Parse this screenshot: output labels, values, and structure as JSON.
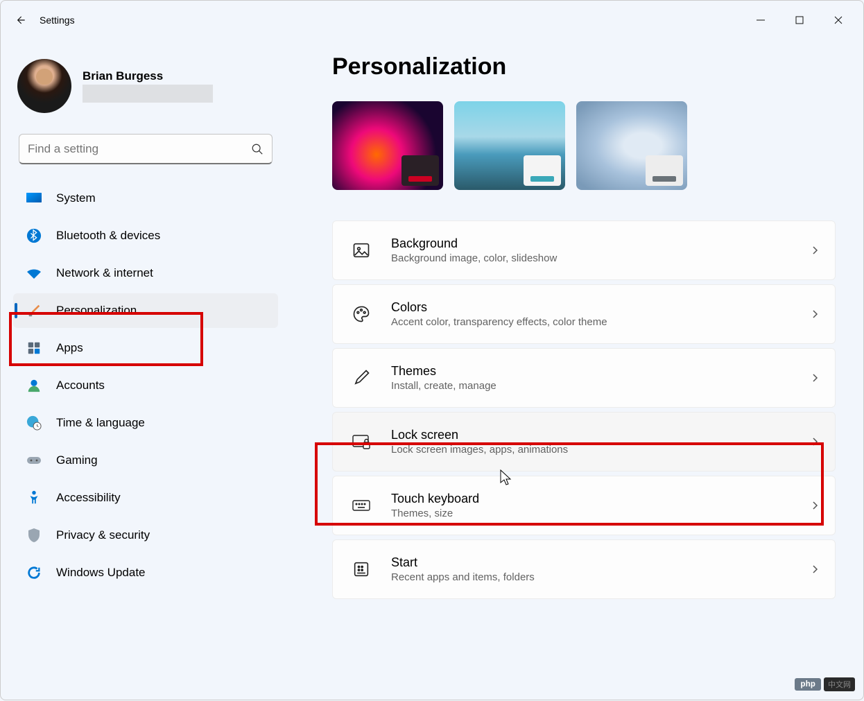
{
  "app": {
    "title": "Settings"
  },
  "user": {
    "name": "Brian Burgess"
  },
  "search": {
    "placeholder": "Find a setting"
  },
  "sidebar": {
    "items": [
      {
        "icon": "system",
        "label": "System"
      },
      {
        "icon": "bluetooth",
        "label": "Bluetooth & devices"
      },
      {
        "icon": "wifi",
        "label": "Network & internet"
      },
      {
        "icon": "brush",
        "label": "Personalization"
      },
      {
        "icon": "apps",
        "label": "Apps"
      },
      {
        "icon": "account",
        "label": "Accounts"
      },
      {
        "icon": "time",
        "label": "Time & language"
      },
      {
        "icon": "gaming",
        "label": "Gaming"
      },
      {
        "icon": "access",
        "label": "Accessibility"
      },
      {
        "icon": "privacy",
        "label": "Privacy & security"
      },
      {
        "icon": "update",
        "label": "Windows Update"
      }
    ]
  },
  "page": {
    "title": "Personalization"
  },
  "settings": [
    {
      "icon": "image",
      "title": "Background",
      "desc": "Background image, color, slideshow"
    },
    {
      "icon": "palette",
      "title": "Colors",
      "desc": "Accent color, transparency effects, color theme"
    },
    {
      "icon": "brush",
      "title": "Themes",
      "desc": "Install, create, manage"
    },
    {
      "icon": "lock",
      "title": "Lock screen",
      "desc": "Lock screen images, apps, animations"
    },
    {
      "icon": "keyboard",
      "title": "Touch keyboard",
      "desc": "Themes, size"
    },
    {
      "icon": "start",
      "title": "Start",
      "desc": "Recent apps and items, folders"
    }
  ],
  "watermark": {
    "left": "php",
    "right": "中文网"
  }
}
